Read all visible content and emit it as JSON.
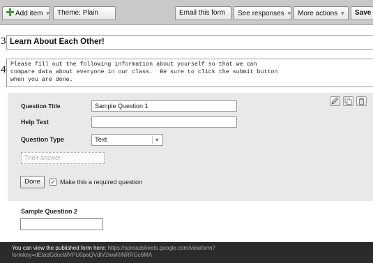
{
  "toolbar": {
    "add_item": "Add item",
    "theme_prefix": "Theme:",
    "theme_value": "Plain",
    "email": "Email this form",
    "responses": "See responses",
    "more_actions": "More actions",
    "save": "Save",
    "caret": "▾"
  },
  "markers": {
    "title": "3·",
    "description": "4·"
  },
  "form": {
    "title": "Learn About Each Other!",
    "description": "Please fill out the following information about yourself so that we can\ncompare data about everyone in our class.  Be sure to click the submit button\nwhen you are done."
  },
  "question_editor": {
    "title_label": "Question Title",
    "title_value": "Sample Question 1",
    "help_label": "Help Text",
    "help_value": "",
    "type_label": "Question Type",
    "type_value": "Text",
    "answer_placeholder": "Their answer",
    "done_label": "Done",
    "required_label": "Make this a required question",
    "required_checked": true,
    "icons": [
      "edit-icon",
      "duplicate-icon",
      "delete-icon"
    ]
  },
  "question2": {
    "title": "Sample Question 2"
  },
  "footer": {
    "text": "You can view the published form here:",
    "url_line1": "https://spreadsheets.google.com/viewform?",
    "url_line2": "formkey=dEtadGducWVPU0paQVdlV2wwRlNRRGc6MA"
  }
}
